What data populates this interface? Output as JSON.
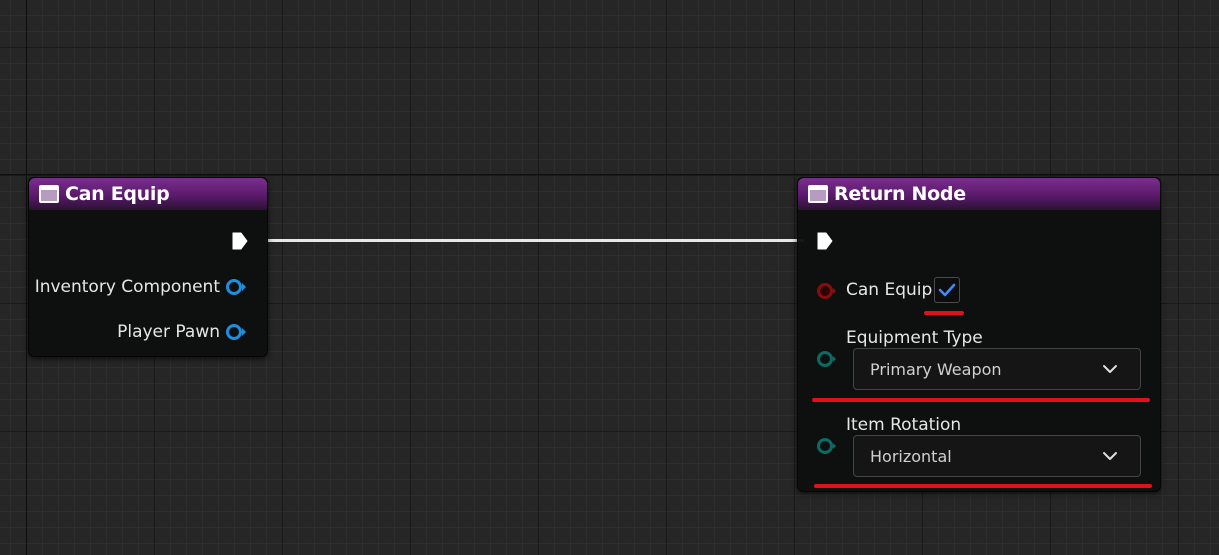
{
  "graph": {
    "nodes": {
      "can_equip": {
        "title": "Can Equip",
        "outputs": [
          {
            "label": "Inventory Component",
            "pin_icon": "object-pin-icon"
          },
          {
            "label": "Player Pawn",
            "pin_icon": "object-pin-icon"
          }
        ]
      },
      "return_node": {
        "title": "Return Node",
        "inputs": {
          "can_equip": {
            "label": "Can Equip",
            "checked": true
          },
          "equipment_type": {
            "label": "Equipment Type",
            "value": "Primary Weapon"
          },
          "item_rotation": {
            "label": "Item Rotation",
            "value": "Horizontal"
          }
        }
      }
    }
  },
  "colors": {
    "header_purple": "#7a2e8e",
    "bool_pin": "#8a0d0d",
    "enum_pin": "#0b6b64",
    "object_pin": "#1c8fe0",
    "checkmark": "#3d8bff",
    "highlight_underline": "#e0111c"
  }
}
